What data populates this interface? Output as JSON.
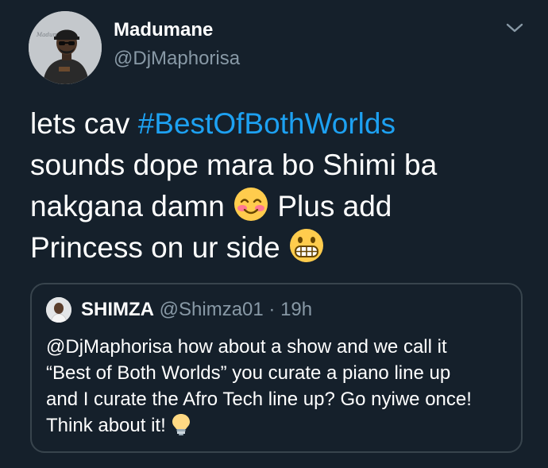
{
  "author": {
    "display_name": "Madumane",
    "handle": "@DjMaphorisa",
    "avatar_icon": "profile-photo"
  },
  "menu_icon": "chevron-down-icon",
  "tweet": {
    "line1_prefix": "lets cav ",
    "hashtag": "#BestOfBothWorlds",
    "line2": "sounds dope mara bo Shimi ba",
    "line3_before_emoji": "nakgana damn ",
    "line3_after_emoji": " Plus add",
    "line4": "Princess on ur side ",
    "emoji_1": "smiling-face-with-blush-icon",
    "emoji_2": "grimacing-face-icon"
  },
  "quoted_tweet": {
    "display_name": "SHIMZA",
    "meta": " @Shimza01 · 19h",
    "lines": [
      "@DjMaphorisa how about a show and we call it",
      "“Best of Both Worlds” you curate a piano line up",
      "and I curate the Afro Tech line up? Go nyiwe once!",
      "Think about it! "
    ],
    "emoji": "light-bulb-icon"
  },
  "colors": {
    "background": "#15202b",
    "text": "#ffffff",
    "secondary_text": "#8899a6",
    "link": "#1da1f2",
    "border": "#38444d"
  }
}
